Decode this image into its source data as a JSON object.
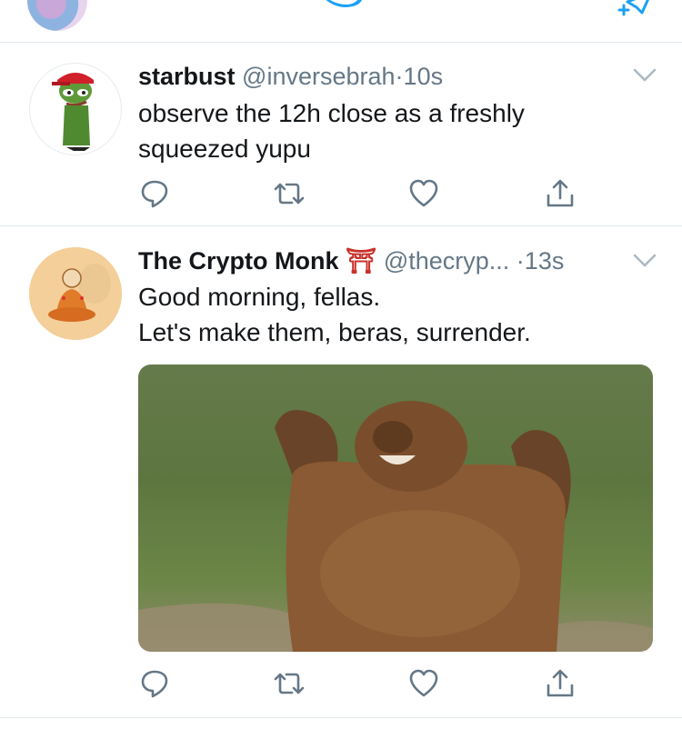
{
  "tweets": [
    {
      "name": "starbust",
      "badge": "",
      "handle": "@inversebrah",
      "separator": "·",
      "time": "10s",
      "lines": [
        "observe the 12h close as a freshly",
        "squeezed yupu"
      ],
      "has_media": false
    },
    {
      "name": "The Crypto Monk",
      "badge": "⛩",
      "handle": "@thecryp...",
      "separator": "·",
      "time": "13s",
      "lines": [
        "Good morning, fellas.",
        "Let's make them, beras, surrender."
      ],
      "has_media": true
    }
  ],
  "icons": {
    "top_bar": [
      "profile-avatar",
      "twitter-bird-icon",
      "compose-tweet-icon"
    ],
    "actions": [
      "reply-icon",
      "retweet-icon",
      "like-icon",
      "share-icon"
    ],
    "caret": "chevron-down-icon"
  },
  "colors": {
    "brand": "#1da1f2",
    "text": "#14171a",
    "muted": "#657786",
    "divider": "#e1e8ed"
  }
}
